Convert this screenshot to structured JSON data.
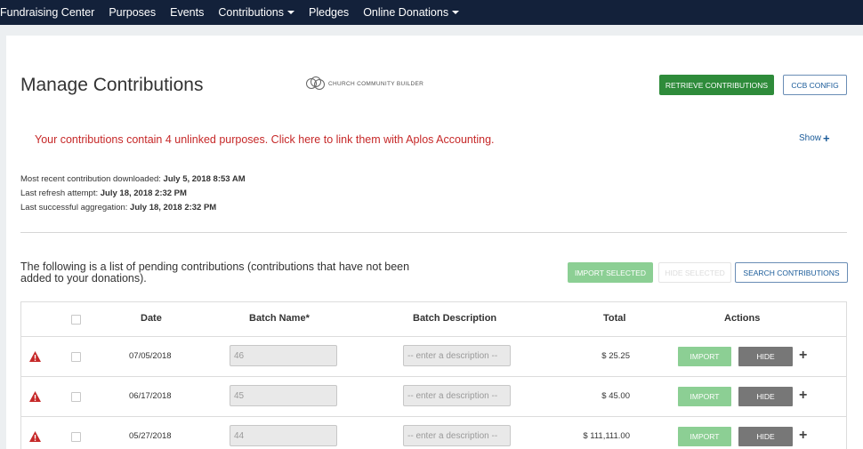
{
  "nav": {
    "items": [
      {
        "label": "Fundraising Center",
        "dropdown": false
      },
      {
        "label": "Purposes",
        "dropdown": false
      },
      {
        "label": "Events",
        "dropdown": false
      },
      {
        "label": "Contributions",
        "dropdown": true
      },
      {
        "label": "Pledges",
        "dropdown": false
      },
      {
        "label": "Online Donations",
        "dropdown": true
      }
    ]
  },
  "header": {
    "title": "Manage Contributions",
    "logo_text": "CHURCH COMMUNITY BUILDER",
    "retrieve_label": "RETRIEVE CONTRIBUTIONS",
    "ccb_config_label": "CCB CONFIG"
  },
  "alert": {
    "message": "Your contributions contain 4 unlinked purposes. Click here to link them with Aplos Accounting.",
    "show_label": "Show",
    "show_icon": "plus-icon"
  },
  "status": {
    "recent_label": "Most recent contribution downloaded:",
    "recent_value": "July 5, 2018 8:53 AM",
    "refresh_label": "Last refresh attempt:",
    "refresh_value": "July 18, 2018 2:32 PM",
    "aggregation_label": "Last successful aggregation:",
    "aggregation_value": "July 18, 2018 2:32 PM"
  },
  "list": {
    "intro": "The following is a list of pending contributions (contributions that have not been added to your donations).",
    "import_selected_label": "IMPORT SELECTED",
    "hide_selected_label": "HIDE SELECTED",
    "search_label": "SEARCH CONTRIBUTIONS"
  },
  "table": {
    "headers": {
      "date": "Date",
      "batch_name": "Batch Name*",
      "batch_description": "Batch Description",
      "total": "Total",
      "actions": "Actions"
    },
    "rows": [
      {
        "date": "07/05/2018",
        "batch": "46",
        "description_placeholder": "-- enter a description --",
        "total": "$ 25.25",
        "import_label": "IMPORT",
        "hide_label": "HIDE"
      },
      {
        "date": "06/17/2018",
        "batch": "45",
        "description_placeholder": "-- enter a description --",
        "total": "$ 45.00",
        "import_label": "IMPORT",
        "hide_label": "HIDE"
      },
      {
        "date": "05/27/2018",
        "batch": "44",
        "description_placeholder": "-- enter a description --",
        "total": "$ 111,111.00",
        "import_label": "IMPORT",
        "hide_label": "HIDE"
      }
    ]
  },
  "colors": {
    "nav_bg": "#13213a",
    "primary_green": "#2e8b3a",
    "light_green": "#8ccf94",
    "alert_red": "#c62828",
    "link_blue": "#1a5b99",
    "hide_gray": "#777777"
  }
}
